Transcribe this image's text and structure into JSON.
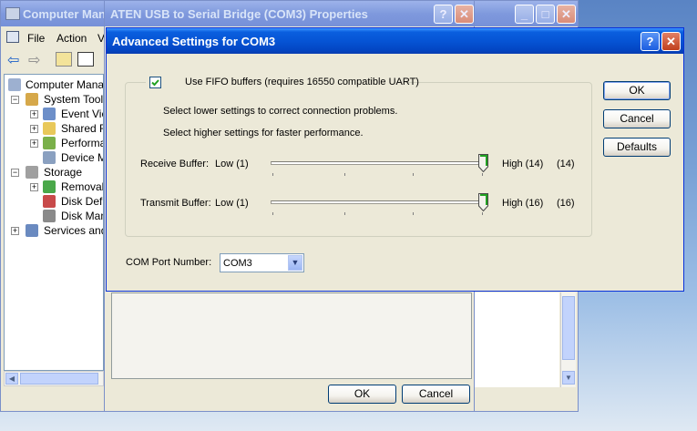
{
  "computer_management": {
    "title": "Computer Mana",
    "menu": [
      "File",
      "Action",
      "V"
    ],
    "tree": [
      {
        "label": "Computer Manage",
        "indent": 0
      },
      {
        "label": "System Tools",
        "indent": 1
      },
      {
        "label": "Event Vie",
        "indent": 2
      },
      {
        "label": "Shared Fo",
        "indent": 2
      },
      {
        "label": "Performa",
        "indent": 2
      },
      {
        "label": "Device Ma",
        "indent": 2
      },
      {
        "label": "Storage",
        "indent": 1
      },
      {
        "label": "Removab",
        "indent": 2
      },
      {
        "label": "Disk Defra",
        "indent": 2
      },
      {
        "label": "Disk Mana",
        "indent": 2
      },
      {
        "label": "Services and",
        "indent": 1
      }
    ]
  },
  "properties": {
    "title": "ATEN USB to Serial Bridge (COM3) Properties",
    "ok_label": "OK",
    "cancel_label": "Cancel"
  },
  "advanced": {
    "title": "Advanced Settings for COM3",
    "fifo_label": "Use FIFO buffers (requires 16550 compatible UART)",
    "fifo_checked": true,
    "hint_lower": "Select lower settings to correct connection problems.",
    "hint_higher": "Select higher settings for faster performance.",
    "receive": {
      "label": "Receive Buffer:",
      "low": "Low (1)",
      "high": "High (14)",
      "value": "(14)",
      "level": 1.0
    },
    "transmit": {
      "label": "Transmit Buffer:",
      "low": "Low (1)",
      "high": "High (16)",
      "value": "(16)",
      "level": 1.0
    },
    "com_port_label": "COM Port Number:",
    "com_port_value": "COM3",
    "ok_label": "OK",
    "cancel_label": "Cancel",
    "defaults_label": "Defaults"
  }
}
